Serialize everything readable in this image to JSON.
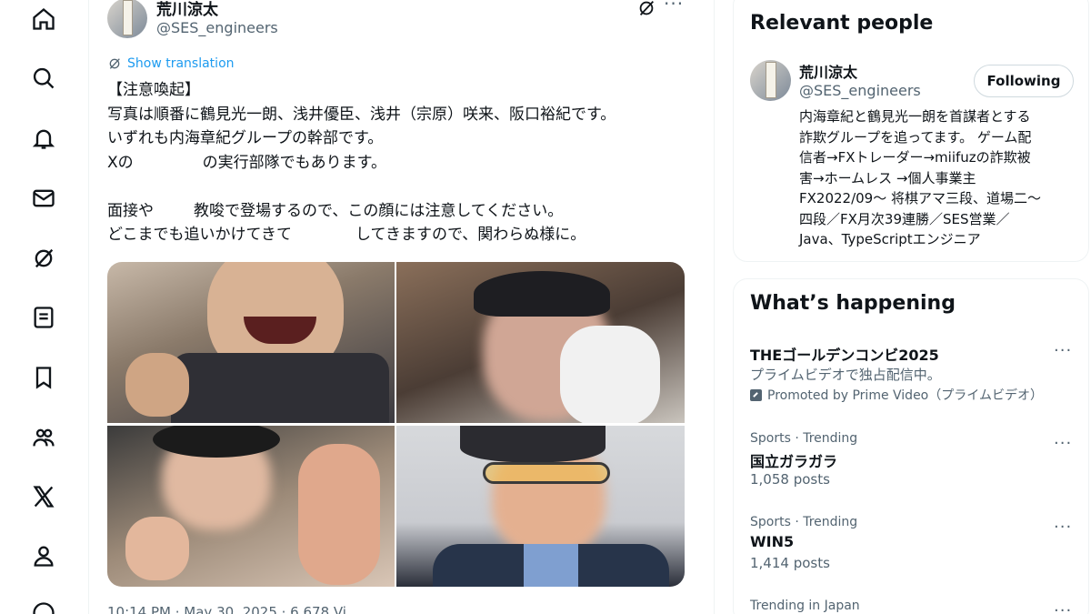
{
  "nav": {
    "items": [
      {
        "name": "home"
      },
      {
        "name": "explore"
      },
      {
        "name": "notifications"
      },
      {
        "name": "messages"
      },
      {
        "name": "grok"
      },
      {
        "name": "lists"
      },
      {
        "name": "bookmarks"
      },
      {
        "name": "communities"
      },
      {
        "name": "premium"
      },
      {
        "name": "profile"
      },
      {
        "name": "more"
      }
    ]
  },
  "post": {
    "author_name": "荒川涼太",
    "author_handle": "@SES_engineers",
    "more_label": "···",
    "show_translation": "Show translation",
    "lines": [
      "【注意喚起】",
      "写真は順番に鶴見光一朗、浅井優臣、浅井（宗原）咲来、阪口裕紀です。",
      "いずれも内海章紀グループの幹部です。",
      "Xの",
      "の実行部隊でもあります。",
      "面接や",
      "教唆で登場するので、この顔には注意してください。",
      "どこまでも追いかけてきて",
      "してきますので、関わらぬ様に。"
    ],
    "timestamp": "10:14 PM · May 30, 2025 · 6,678 Vi"
  },
  "relevant_people": {
    "title": "Relevant people",
    "person": {
      "name": "荒川涼太",
      "handle": "@SES_engineers",
      "follow_label": "Following",
      "bio_lines": [
        "内海章紀と鶴見光一朗を首謀者とする",
        "詐欺グループを追ってます。 ゲーム配",
        "信者→FXトレーダー→miifuzの詐欺被",
        "害→ホームレス →個人事業主",
        "FX2022/09〜 将棋アマ三段、道場二〜",
        "四段／FX月次39連勝／SES営業／",
        "Java、TypeScriptエンジニア"
      ]
    }
  },
  "whats_happening": {
    "title": "What’s happening",
    "more_label": "···",
    "items": [
      {
        "title": "THEゴールデンコンビ2025",
        "subtitle": "プライムビデオで独占配信中。",
        "promo": "Promoted by Prime Video（プライムビデオ）"
      },
      {
        "meta": "Sports · Trending",
        "title": "国立ガラガラ",
        "posts": "1,058 posts"
      },
      {
        "meta": "Sports · Trending",
        "title": "WIN5",
        "posts": "1,414 posts"
      },
      {
        "meta": "Trending in Japan"
      }
    ]
  }
}
